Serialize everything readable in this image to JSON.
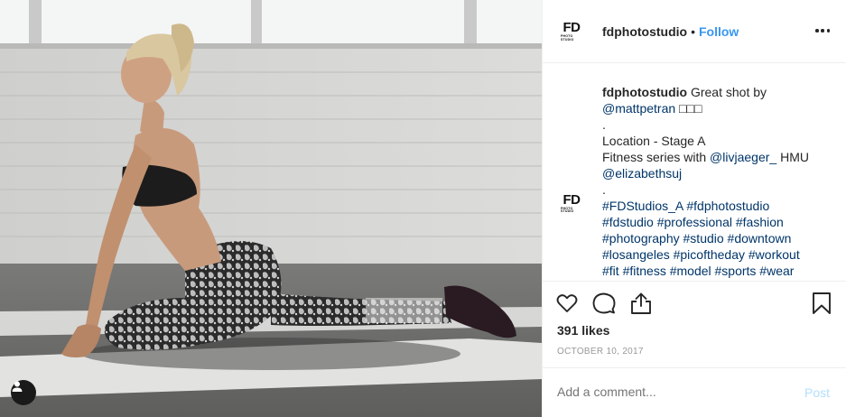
{
  "account": {
    "username": "fdphotostudio",
    "separator": "•",
    "follow_label": "Follow",
    "logo_text": "FD",
    "logo_subtext": "PHOTO STUDIO"
  },
  "caption": {
    "username": "fdphotostudio",
    "lines": [
      {
        "text": "Great shot by"
      },
      {
        "mention": "@mattpetran",
        "suffix": " □□□"
      },
      {
        "text": "."
      },
      {
        "text": "Location - Stage A"
      },
      {
        "text": "Fitness series with ",
        "mention": "@livjaeger_",
        "suffix": " HMU"
      },
      {
        "mention": "@elizabethsuj"
      },
      {
        "text": "."
      },
      {
        "hashtags": "#FDStudios_A #fdphotostudio"
      },
      {
        "hashtags": "#fdstudio #professional #fashion"
      },
      {
        "hashtags": "#photography #studio #downtown"
      },
      {
        "hashtags": "#losangeles #picoftheday #workout"
      },
      {
        "hashtags": "#fit #fitness #model #sports #wear"
      }
    ]
  },
  "stats": {
    "likes": "391 likes",
    "date": "OCTOBER 10, 2017"
  },
  "comment_box": {
    "placeholder": "Add a comment...",
    "post_label": "Post"
  },
  "colors": {
    "link": "#003569",
    "follow": "#3897f0",
    "post_disabled": "#b2dffc",
    "muted": "#999999",
    "border": "#efefef"
  },
  "icons": {
    "like": "heart-icon",
    "comment": "speech-bubble-icon",
    "share": "share-icon",
    "save": "bookmark-icon",
    "more": "ellipsis-icon",
    "tags": "user-tag-icon"
  }
}
